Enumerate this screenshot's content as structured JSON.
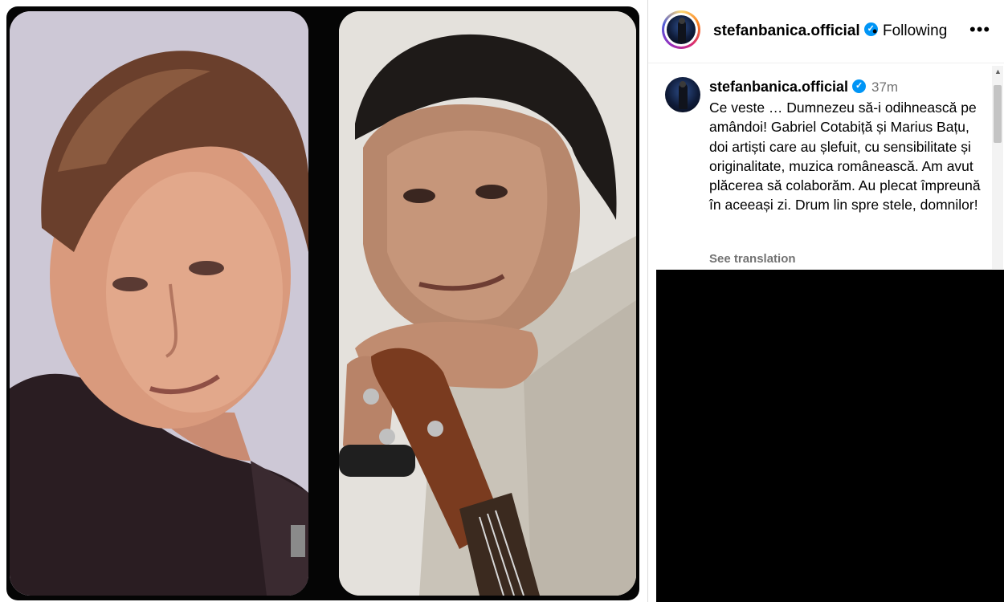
{
  "post": {
    "username": "stefanbanica.official",
    "follow_status": "Following",
    "time_ago": "37m",
    "caption": "Ce veste … Dumnezeu să-i odihnească pe amândoi! Gabriel Cotabiță și Marius Bațu, doi artiști care au șlefuit, cu sensibilitate și originalitate, muzica românească. Am avut plăcerea să colaborăm. Au plecat împreună în aceeași zi. Drum lin spre stele, domnilor!",
    "see_translation": "See translation",
    "more_label": "•••",
    "separator": "•",
    "verified_mark": "✓"
  },
  "icons": {
    "verified": "verified-badge-icon",
    "more": "more-options-icon",
    "scroll_up": "scroll-up-arrow-icon"
  },
  "colors": {
    "verified_blue": "#0095f6",
    "secondary_text": "#737373",
    "story_ring": [
      "#feda75",
      "#fa7e1e",
      "#d62976",
      "#962fbf",
      "#4f5bd5"
    ]
  }
}
